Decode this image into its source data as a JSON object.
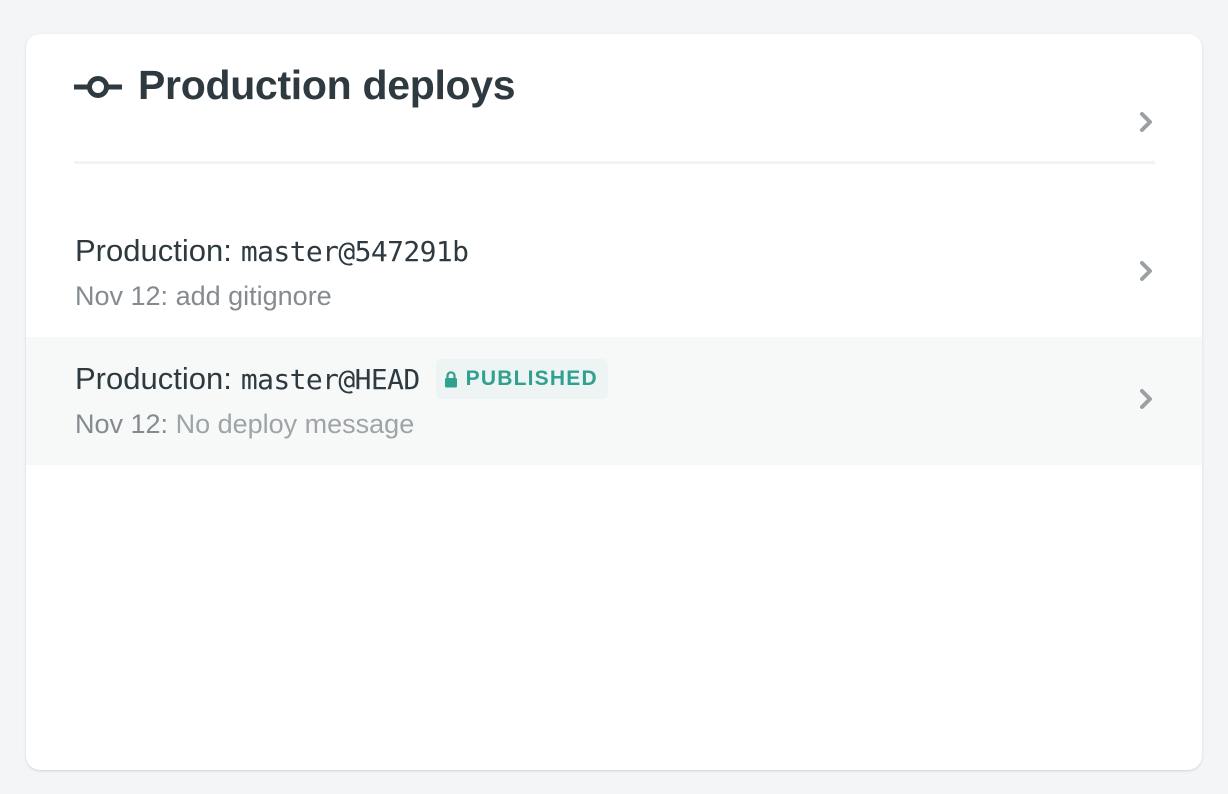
{
  "panel": {
    "title": "Production deploys",
    "title_icon": "git-commit-icon",
    "more_icon": "chevron-right-icon"
  },
  "deploys": [
    {
      "environment": "Production:",
      "ref": "master@547291b",
      "date": "Nov 12:",
      "message": "add gitignore",
      "published": false
    },
    {
      "environment": "Production:",
      "ref": "master@HEAD",
      "date": "Nov 12:",
      "message": "No deploy message",
      "published": true,
      "badge_label": "PUBLISHED",
      "badge_icon": "lock-icon"
    }
  ],
  "colors": {
    "badge_text": "#30a08f",
    "badge_bg": "#eef3f3",
    "heading": "#2e3a40",
    "muted": "#848b8f",
    "chevron": "#9aa1a5"
  }
}
